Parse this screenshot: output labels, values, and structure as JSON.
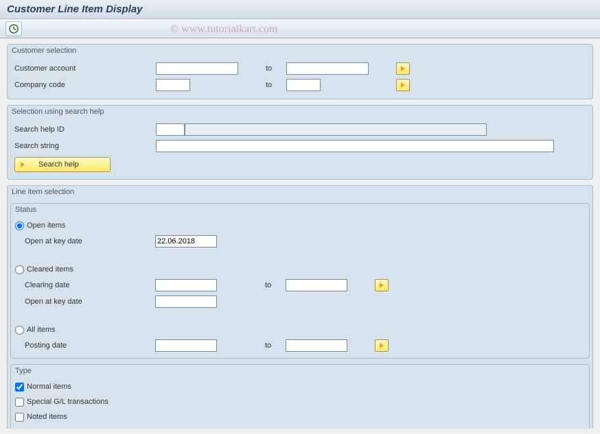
{
  "title": "Customer Line Item Display",
  "watermark": "© www.tutorialkart.com",
  "customer_selection": {
    "title": "Customer selection",
    "rows": [
      {
        "label": "Customer account",
        "from": "",
        "to_label": "to",
        "to": ""
      },
      {
        "label": "Company code",
        "from": "",
        "to_label": "to",
        "to": ""
      }
    ]
  },
  "search_help": {
    "title": "Selection using search help",
    "id_label": "Search help ID",
    "id_value": "",
    "id_desc": "",
    "string_label": "Search string",
    "string_value": "",
    "button_label": "Search help"
  },
  "line_item": {
    "title": "Line item selection",
    "status": {
      "title": "Status",
      "open_label": "Open items",
      "open_key_date_label": "Open at key date",
      "open_key_date_value": "22.06.2018",
      "cleared_label": "Cleared items",
      "clearing_date_label": "Clearing date",
      "clearing_from": "",
      "clearing_to_label": "to",
      "clearing_to": "",
      "cleared_key_date_label": "Open at key date",
      "cleared_key_date_value": "",
      "all_label": "All items",
      "posting_date_label": "Posting date",
      "posting_from": "",
      "posting_to_label": "to",
      "posting_to": "",
      "selected": "open"
    },
    "type": {
      "title": "Type",
      "normal_label": "Normal items",
      "normal_checked": true,
      "special_label": "Special G/L transactions",
      "special_checked": false,
      "noted_label": "Noted items",
      "noted_checked": false
    }
  }
}
